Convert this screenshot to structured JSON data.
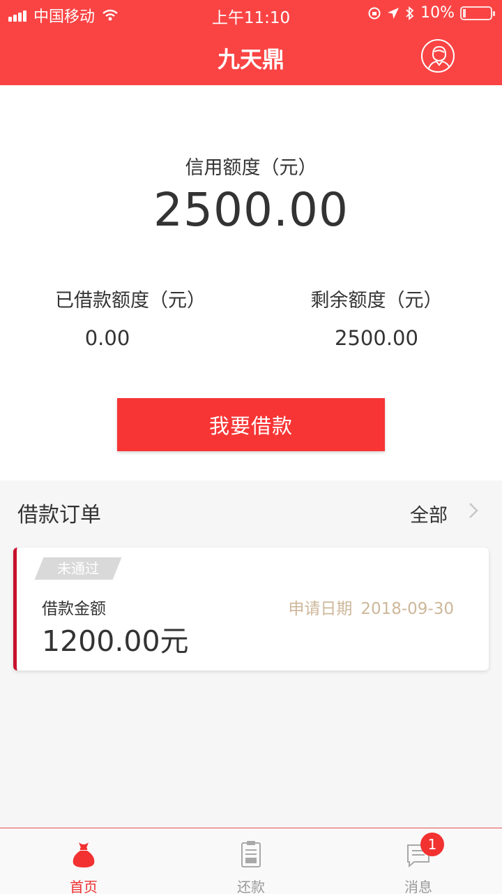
{
  "status_bar": {
    "carrier": "中国移动",
    "time": "上午11:10",
    "battery": "10%",
    "battery_level": 0.1
  },
  "nav": {
    "title": "九天鼎",
    "avatar_icon": "user-avatar-icon"
  },
  "credit": {
    "label": "信用额度（元）",
    "value": "2500.00"
  },
  "borrowed": {
    "label": "已借款额度（元）",
    "value": "0.00"
  },
  "remaining": {
    "label": "剩余额度（元）",
    "value": "2500.00"
  },
  "borrow_button": "我要借款",
  "orders": {
    "title": "借款订单",
    "all_label": "全部",
    "items": [
      {
        "status": "未通过",
        "amount_label": "借款金额",
        "amount": "1200.00元",
        "date_label": "申请日期",
        "date": "2018-09-30"
      }
    ]
  },
  "tabs": [
    {
      "label": "首页",
      "icon": "money-bag-icon",
      "active": true
    },
    {
      "label": "还款",
      "icon": "clipboard-icon",
      "active": false
    },
    {
      "label": "消息",
      "icon": "message-icon",
      "active": false,
      "badge": "1"
    }
  ],
  "colors": {
    "brand": "#fa4444",
    "button": "#f73535",
    "card_accent": "#c8102e",
    "date": "#cdb79a"
  }
}
